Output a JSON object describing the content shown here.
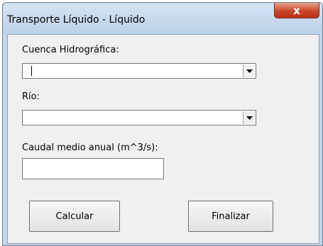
{
  "window": {
    "title": "Transporte Líquido - Líquido",
    "close_glyph": "x"
  },
  "form": {
    "cuenca_label": "Cuenca Hidrográfica:",
    "cuenca_value": "",
    "rio_label": "Río:",
    "rio_value": "",
    "caudal_label": "Caudal medio anual (m^3/s):",
    "caudal_value": ""
  },
  "buttons": {
    "calcular": "Calcular",
    "finalizar": "Finalizar"
  },
  "icons": {
    "dropdown": "chevron-down-icon",
    "close": "close-icon"
  }
}
